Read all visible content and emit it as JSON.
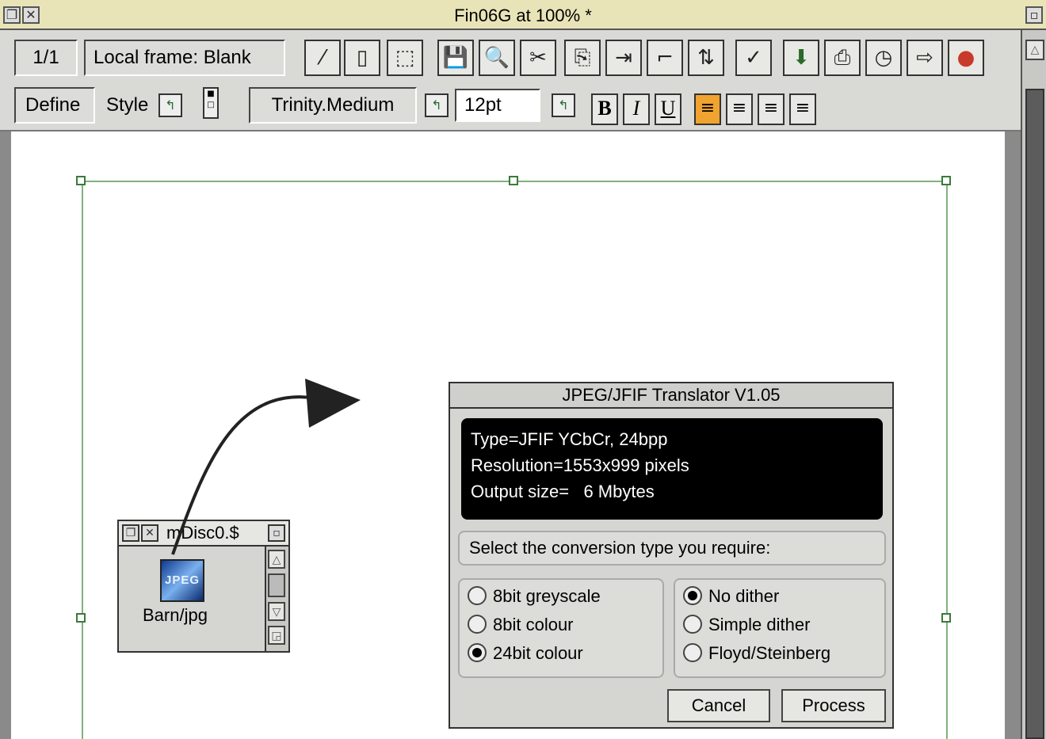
{
  "window": {
    "title": "Fin06G at 100% *"
  },
  "toolbar": {
    "page_indicator": "1/1",
    "frame_info": "Local frame: Blank",
    "define_label": "Define",
    "style_label": "Style",
    "font_value": "Trinity.Medium",
    "size_value": "12pt",
    "bold_label": "B",
    "italic_label": "I",
    "underline_label": "U",
    "icons": [
      "new-frame-icon",
      "frame-icon",
      "dotted-frame-icon",
      "save-icon",
      "zoom-icon",
      "cut-icon",
      "paste-icon",
      "import-icon",
      "link-icon",
      "arrange-icon",
      "spellcheck-icon",
      "load-icon",
      "print-icon",
      "clock-icon",
      "export-icon",
      "colour-icon"
    ]
  },
  "filer": {
    "title": "mDisc0.$",
    "file_label": "Barn/jpg",
    "file_icon_text": "JPEG"
  },
  "dialog": {
    "title": "JPEG/JFIF Translator V1.05",
    "info_type": "Type=JFIF YCbCr, 24bpp",
    "info_resolution": "Resolution=1553x999 pixels",
    "info_output": "Output size=   6 Mbytes",
    "prompt": "Select the conversion type you require:",
    "conversion_options": [
      {
        "label": "8bit greyscale",
        "selected": false
      },
      {
        "label": "8bit colour",
        "selected": false
      },
      {
        "label": "24bit colour",
        "selected": true
      }
    ],
    "dither_options": [
      {
        "label": "No dither",
        "selected": true
      },
      {
        "label": "Simple dither",
        "selected": false
      },
      {
        "label": "Floyd/Steinberg",
        "selected": false
      }
    ],
    "cancel_label": "Cancel",
    "process_label": "Process"
  }
}
